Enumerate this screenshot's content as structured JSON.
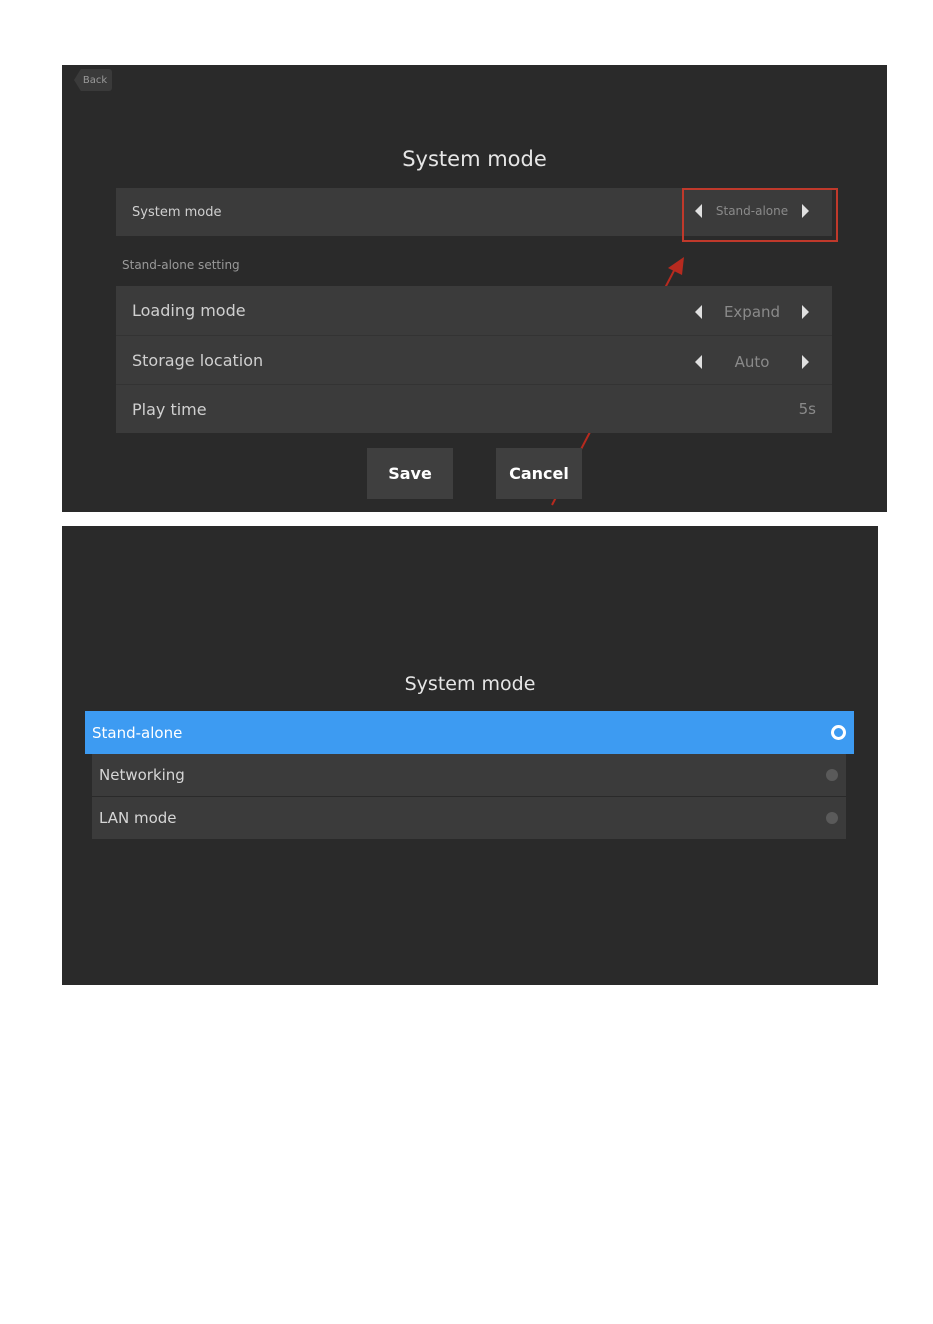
{
  "screen1": {
    "back_label": "Back",
    "title": "System mode",
    "system_mode": {
      "label": "System mode",
      "value": "Stand-alone"
    },
    "section_label": "Stand-alone setting",
    "settings": [
      {
        "label": "Loading mode",
        "value": "Expand"
      },
      {
        "label": "Storage location",
        "value": "Auto"
      },
      {
        "label": "Play time",
        "value": "5s"
      }
    ],
    "save_label": "Save",
    "cancel_label": "Cancel"
  },
  "screen2": {
    "title": "System mode",
    "options": [
      {
        "label": "Stand-alone",
        "selected": true
      },
      {
        "label": "Networking",
        "selected": false
      },
      {
        "label": "LAN mode",
        "selected": false
      }
    ]
  },
  "colors": {
    "screen_bg": "#2a2a2a",
    "row_bg": "#3b3b3b",
    "selected_bg": "#3d9bf2",
    "highlight": "#c0392b"
  },
  "icons": [
    "back-icon",
    "arrow-left-icon",
    "arrow-right-icon",
    "radio-icon"
  ]
}
